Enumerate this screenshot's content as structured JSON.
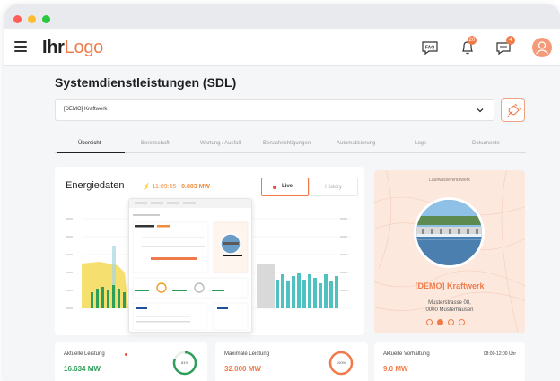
{
  "app": {
    "logo_bold": "Ihr",
    "logo_accent": "Logo",
    "notifications_count": "20",
    "messages_count": "4",
    "faq_label": "FAQ"
  },
  "page": {
    "title": "Systemdienstleistungen (SDL)",
    "plant_select": "[DEMO] Kraftwerk"
  },
  "tabs": [
    "Übersicht",
    "Bereitschaft",
    "Wartung / Ausfall",
    "Benachrichtigungen",
    "Automatisierung",
    "Logs",
    "Dokumente"
  ],
  "energy": {
    "title": "Energiedaten",
    "time": "11:09:55",
    "power": "0.803 MW",
    "live_label": "Live",
    "history_label": "History"
  },
  "plant": {
    "type": "Laufwasserkraftwerk",
    "name": "[DEMO] Kraftwerk",
    "street": "Musterstrasse 08,",
    "city": "0000 Musterhausen",
    "slides": 4,
    "active_slide": 1
  },
  "stats": {
    "current": {
      "label": "Aktuelle Leistung",
      "value": "16.634 MW",
      "percent": "81%",
      "fraction": 0.81
    },
    "max": {
      "label": "Maximale Leistung",
      "value": "32.000 MW",
      "percent": "100%",
      "fraction": 1.0
    },
    "reserve": {
      "label": "Aktuelle Vorhaltung",
      "value": "9.0 MW",
      "time_window": "08:00-12:00 Uhr"
    }
  },
  "colors": {
    "accent": "#f07b4a",
    "green": "#2e9e5a",
    "teal": "#4fc1c0",
    "yellow": "#f5df6e"
  }
}
